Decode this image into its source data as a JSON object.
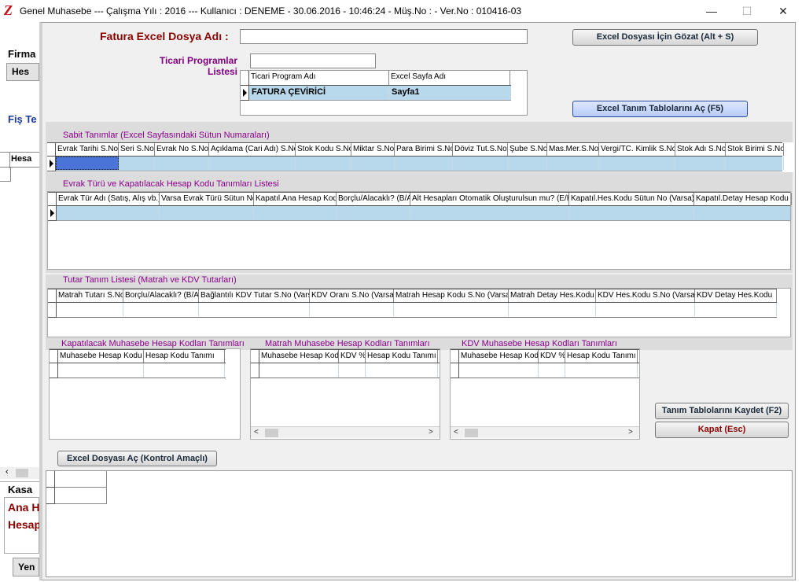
{
  "titlebar": {
    "title": "Genel Muhasebe  ---  Çalışma Yılı : 2016  ---  Kullanıcı : DENEME - 30.06.2016 - 10:46:24 - Müş.No :  - Ver.No : 010416-03",
    "logo": "Z",
    "minimize": "—",
    "maximize": "☐",
    "close": "✕"
  },
  "background": {
    "firma": "Firma",
    "hes_btn": "Hes",
    "fis_te": "Fiş Te",
    "hesap_col": "Hesa",
    "kasa": "Kasa",
    "ana_h": "Ana H",
    "hesap": "Hesap",
    "yen_btn": "Yen",
    "scroll_left": "‹"
  },
  "dialog": {
    "fatura_label": "Fatura Excel Dosya Adı :",
    "fatura_value": "",
    "browse_button": "Excel Dosyası İçin Gözat (Alt + S)",
    "ticari_label": "Ticari Programlar Listesi",
    "ticari_search": "",
    "ticari_grid": {
      "headers": [
        "Ticari Program Adı",
        "Excel Sayfa Adı"
      ],
      "rows": [
        [
          "FATURA ÇEVİRİCİ",
          "Sayfa1"
        ]
      ]
    },
    "open_tables_button": "Excel Tanım Tablolarını Aç (F5)",
    "sabit": {
      "title": "Sabit Tanımlar (Excel Sayfasındaki Sütun Numaraları)",
      "headers": [
        "Evrak Tarihi S.No",
        "Seri S.No",
        "Evrak No S.No",
        "Açıklama (Cari Adı) S.No",
        "Stok Kodu S.No",
        "Miktar S.No",
        "Para Birimi S.No",
        "Döviz Tut.S.No",
        "Şube S.No",
        "Mas.Mer.S.No",
        "Vergi/TC. Kimlik S.No",
        "Stok Adı S.No",
        "Stok Birimi S.No"
      ]
    },
    "evrak": {
      "title": "Evrak Türü ve Kapatılacak Hesap Kodu Tanımları Listesi",
      "headers": [
        "Evrak Tür Adı (Satış, Alış vb.)",
        "Varsa Evrak Türü Sütun No",
        "Kapatıl.Ana Hesap Kodu",
        "Borçlu/Alacaklı? (B/A)",
        "Alt Hesapları Otomatik Oluşturulsun mu? (E/H)",
        "Kapatıl.Hes.Kodu Sütun No (Varsa)",
        "Kapatıl.Detay Hesap Kodu"
      ]
    },
    "tutar": {
      "title": "Tutar Tanım Listesi (Matrah ve KDV Tutarları)",
      "headers": [
        "Matrah Tutarı S.No",
        "Borçlu/Alacaklı? (B/A)",
        "Bağlantılı KDV Tutar S.No (Varsa)",
        "KDV Oranı S.No (Varsa)",
        "Matrah Hesap Kodu S.No (Varsa)",
        "Matrah Detay Hes.Kodu",
        "KDV Hes.Kodu S.No (Varsa)",
        "KDV Detay Hes.Kodu"
      ]
    },
    "kapatilacak": {
      "title": "Kapatılacak Muhasebe Hesap Kodları Tanımları",
      "headers": [
        "Muhasebe Hesap Kodu",
        "Hesap Kodu Tanımı"
      ]
    },
    "matrah": {
      "title": "Matrah Muhasebe Hesap Kodları Tanımları",
      "headers": [
        "Muhasebe Hesap Kodu",
        "KDV %",
        "Hesap Kodu Tanımı"
      ]
    },
    "kdv": {
      "title": "KDV Muhasebe Hesap Kodları Tanımları",
      "headers": [
        "Muhasebe Hesap Kodu",
        "KDV %",
        "Hesap Kodu Tanımı"
      ]
    },
    "save_button": "Tanım Tablolarını Kaydet (F2)",
    "close_button": "Kapat (Esc)",
    "open_excel_button": "Excel Dosyası Aç (Kontrol Amaçlı)",
    "scroll_left": "<",
    "scroll_right": ">"
  }
}
